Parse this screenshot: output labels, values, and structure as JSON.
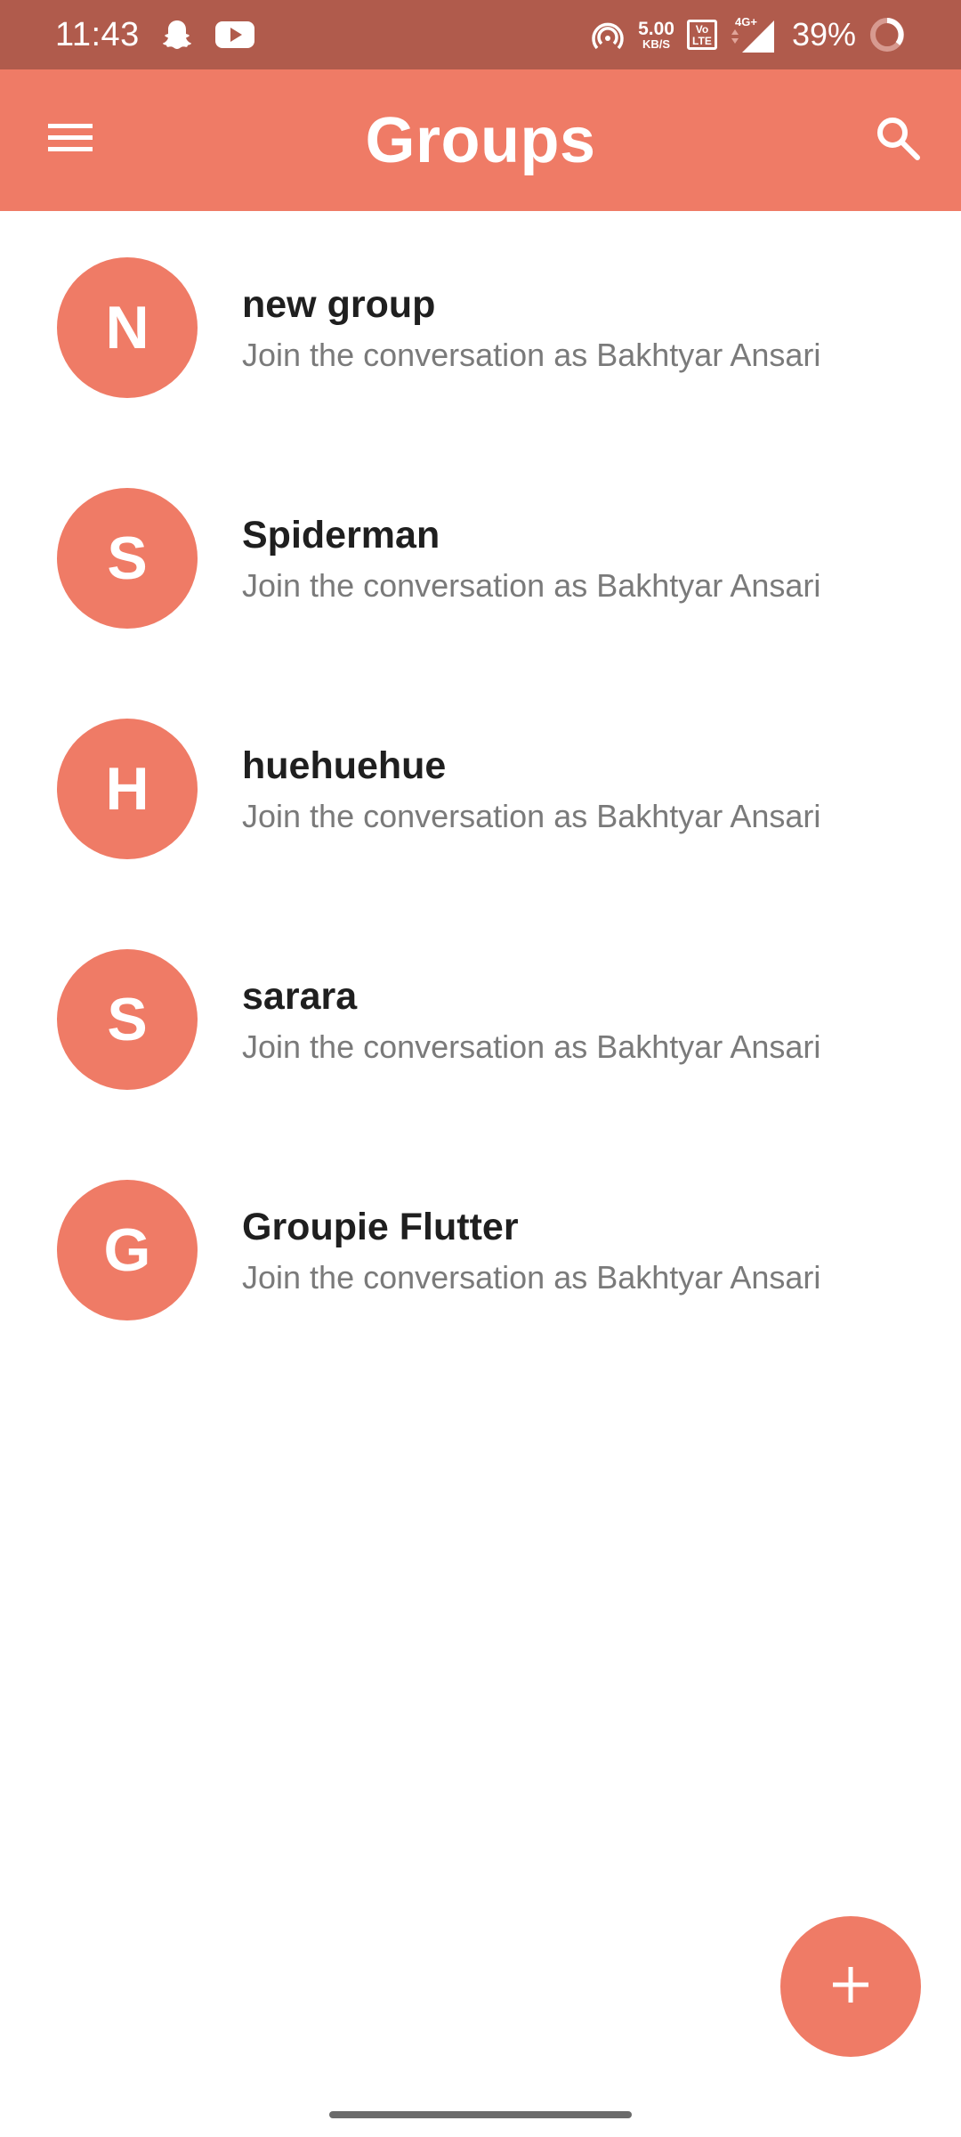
{
  "status_bar": {
    "time": "11:43",
    "net_speed_value": "5.00",
    "net_speed_unit": "KB/S",
    "volte_label": "Vo LTE",
    "network_type": "4G+",
    "battery_percent": "39%"
  },
  "app_bar": {
    "title": "Groups",
    "menu_icon": "hamburger-menu-icon",
    "search_icon": "search-icon"
  },
  "groups": [
    {
      "initial": "N",
      "name": "new group",
      "subtitle": "Join the conversation as Bakhtyar Ansari"
    },
    {
      "initial": "S",
      "name": "Spiderman",
      "subtitle": "Join the conversation as Bakhtyar Ansari"
    },
    {
      "initial": "H",
      "name": "huehuehue",
      "subtitle": "Join the conversation as Bakhtyar Ansari"
    },
    {
      "initial": "S",
      "name": "sarara",
      "subtitle": "Join the conversation as Bakhtyar Ansari"
    },
    {
      "initial": "G",
      "name": "Groupie Flutter",
      "subtitle": "Join the conversation as Bakhtyar Ansari"
    }
  ],
  "fab": {
    "icon": "plus-icon"
  },
  "colors": {
    "status_bar": "#b05b4c",
    "accent": "#ef7b66",
    "title_text": "#1f1f1f",
    "subtitle_text": "#7a7a7a"
  }
}
